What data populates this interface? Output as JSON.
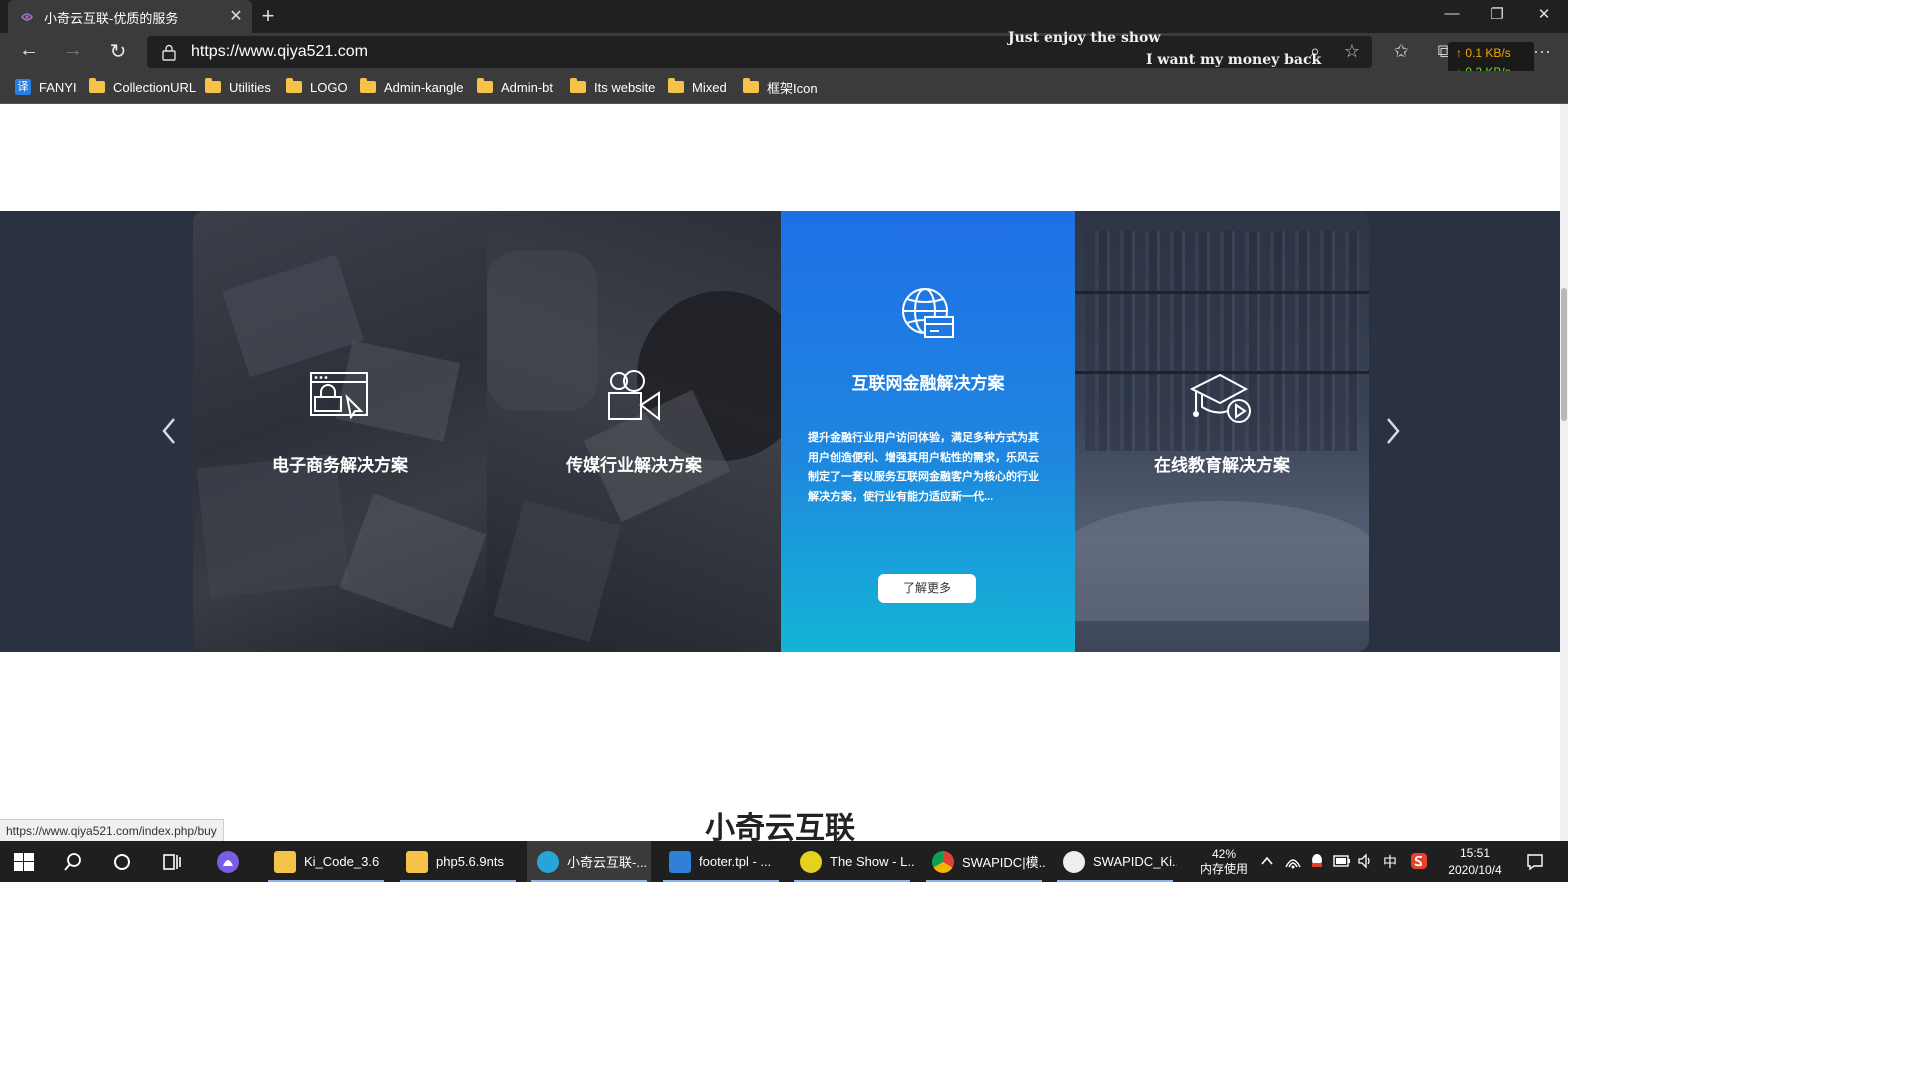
{
  "browser": {
    "tab_title": "小奇云互联-优质的服务",
    "tab_close": "✕",
    "new_tab": "+",
    "url": "https://www.qiya521.com",
    "overlay_line1": "Just enjoy the show",
    "overlay_line2": "I want my money back",
    "net_up": "↑ 0.1 KB/s",
    "net_down": "↓ 0.2 KB/s",
    "window_controls": {
      "minimize": "—",
      "restore": "❐",
      "close": "✕"
    },
    "nav": {
      "back": "←",
      "forward": "→",
      "refresh": "↻"
    },
    "toolbar_icons": {
      "zoom": "⌕",
      "favorite": "☆",
      "favorites_list": "✩",
      "collections": "⧉",
      "more": "···"
    }
  },
  "bookmarks": [
    {
      "label": "FANYI",
      "icon": "translate-icon",
      "badge": "译"
    },
    {
      "label": "CollectionURL",
      "icon": "folder-icon"
    },
    {
      "label": "Utilities",
      "icon": "folder-icon"
    },
    {
      "label": "LOGO",
      "icon": "folder-icon"
    },
    {
      "label": "Admin-kangle",
      "icon": "folder-icon"
    },
    {
      "label": "Admin-bt",
      "icon": "folder-icon"
    },
    {
      "label": "Its website",
      "icon": "folder-icon"
    },
    {
      "label": "Mixed",
      "icon": "folder-icon"
    },
    {
      "label": "框架Icon",
      "icon": "folder-icon"
    }
  ],
  "solutions": {
    "cards": [
      {
        "title": "电子商务解决方案",
        "icon": "ecommerce-browser-icon"
      },
      {
        "title": "传媒行业解决方案",
        "icon": "video-camera-icon"
      },
      {
        "title": "互联网金融解决方案",
        "icon": "globe-card-icon",
        "description": "提升金融行业用户访问体验，满足多种方式为其用户创造便利、增强其用户粘性的需求，乐风云制定了一套以服务互联网金融客户为核心的行业解决方案，使行业有能力适应新一代...",
        "button": "了解更多"
      },
      {
        "title": "在线教育解决方案",
        "icon": "graduation-cap-play-icon"
      }
    ]
  },
  "page": {
    "brand": "小奇云互联",
    "status_link": "https://www.qiya521.com/index.php/buy"
  },
  "taskbar": {
    "apps": [
      {
        "label": "Ki_Code_3.6",
        "icon": "folder-icon",
        "color": "#f5c348"
      },
      {
        "label": "php5.6.9nts",
        "icon": "folder-icon",
        "color": "#f5c348"
      },
      {
        "label": "小奇云互联-...",
        "icon": "edge-icon",
        "color": "#2aa3d6"
      },
      {
        "label": "footer.tpl - ...",
        "icon": "vscode-icon",
        "color": "#2f80d8"
      },
      {
        "label": "The Show - L...",
        "icon": "music-player-icon",
        "color": "#e4d21e"
      },
      {
        "label": "SWAPIDC|模...",
        "icon": "chrome-icon",
        "color": "#db4437"
      },
      {
        "label": "SWAPIDC_Ki...",
        "icon": "app-icon",
        "color": "#eeeeee"
      }
    ],
    "memory_percent": "42%",
    "memory_label": "内存使用",
    "ime": "中",
    "time": "15:51",
    "date": "2020/10/4"
  },
  "colors": {
    "band_background": "#2a3140",
    "highlight_card_top": "#1f6fe6",
    "highlight_card_bottom": "#14b5d6"
  }
}
